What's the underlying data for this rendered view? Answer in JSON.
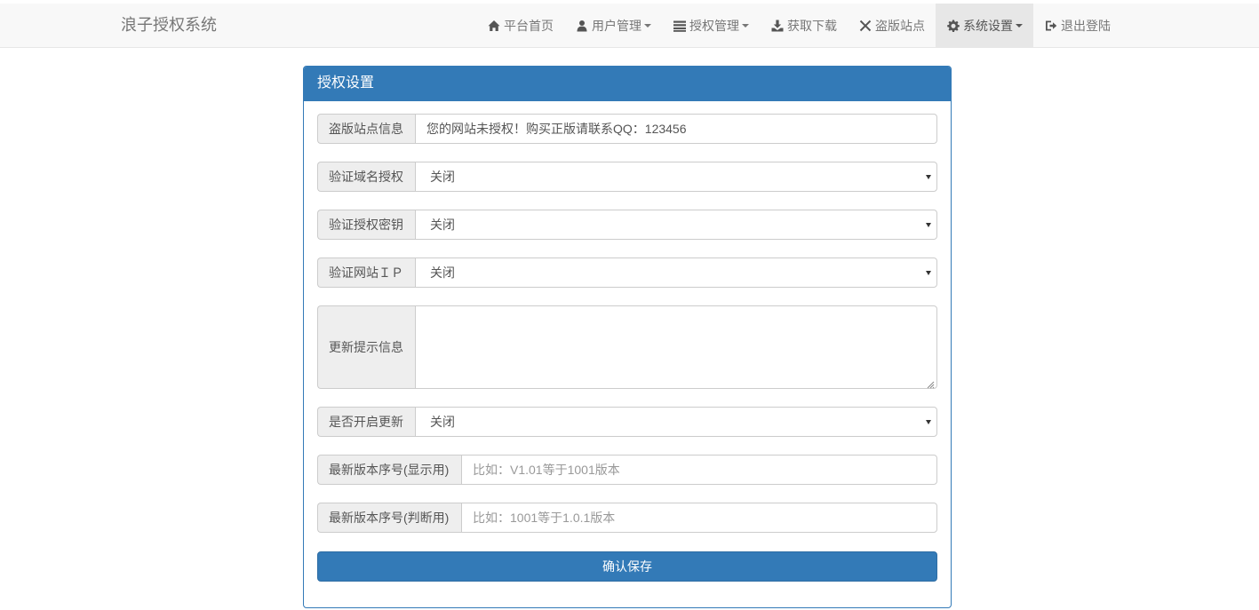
{
  "brand": "浪子授权系统",
  "nav": {
    "home": "平台首页",
    "users": "用户管理",
    "auth": "授权管理",
    "download": "获取下载",
    "pirate": "盗版站点",
    "settings": "系统设置",
    "logout": "退出登陆"
  },
  "panel": {
    "title": "授权设置"
  },
  "form": {
    "pirate_info": {
      "label": "盗版站点信息",
      "value": "您的网站未授权！购买正版请联系QQ：123456"
    },
    "verify_domain": {
      "label": "验证域名授权",
      "value": "关闭"
    },
    "verify_key": {
      "label": "验证授权密钥",
      "value": "关闭"
    },
    "verify_ip": {
      "label": "验证网站ＩＰ",
      "value": "关闭"
    },
    "update_message": {
      "label": "更新提示信息",
      "value": ""
    },
    "enable_update": {
      "label": "是否开启更新",
      "value": "关闭"
    },
    "version_display": {
      "label": "最新版本序号(显示用)",
      "placeholder": "比如：V1.01等于1001版本"
    },
    "version_judge": {
      "label": "最新版本序号(判断用)",
      "placeholder": "比如：1001等于1.0.1版本"
    }
  },
  "save_button": "确认保存",
  "colors": {
    "primary": "#337ab7",
    "navbar_bg": "#f8f8f8",
    "addon_bg": "#eeeeee"
  }
}
